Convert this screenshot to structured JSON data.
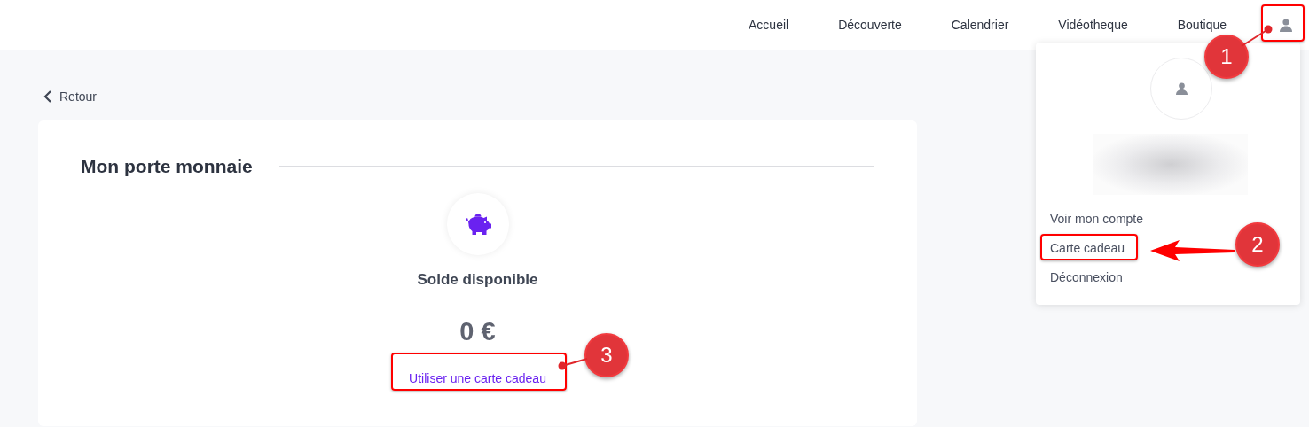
{
  "nav": {
    "links": [
      {
        "label": "Accueil"
      },
      {
        "label": "Découverte"
      },
      {
        "label": "Calendrier"
      },
      {
        "label": "Vidéotheque"
      },
      {
        "label": "Boutique"
      }
    ]
  },
  "back_link": "Retour",
  "wallet": {
    "title": "Mon porte monnaie",
    "balance_label": "Solde disponible",
    "balance": "0 €",
    "action": "Utiliser une carte cadeau"
  },
  "account_menu": {
    "expanded": true,
    "items": [
      {
        "label": "Voir mon compte"
      },
      {
        "label": "Carte cadeau"
      },
      {
        "label": "Déconnexion"
      }
    ]
  },
  "annotations": [
    {
      "number": "1"
    },
    {
      "number": "2"
    },
    {
      "number": "3"
    }
  ]
}
